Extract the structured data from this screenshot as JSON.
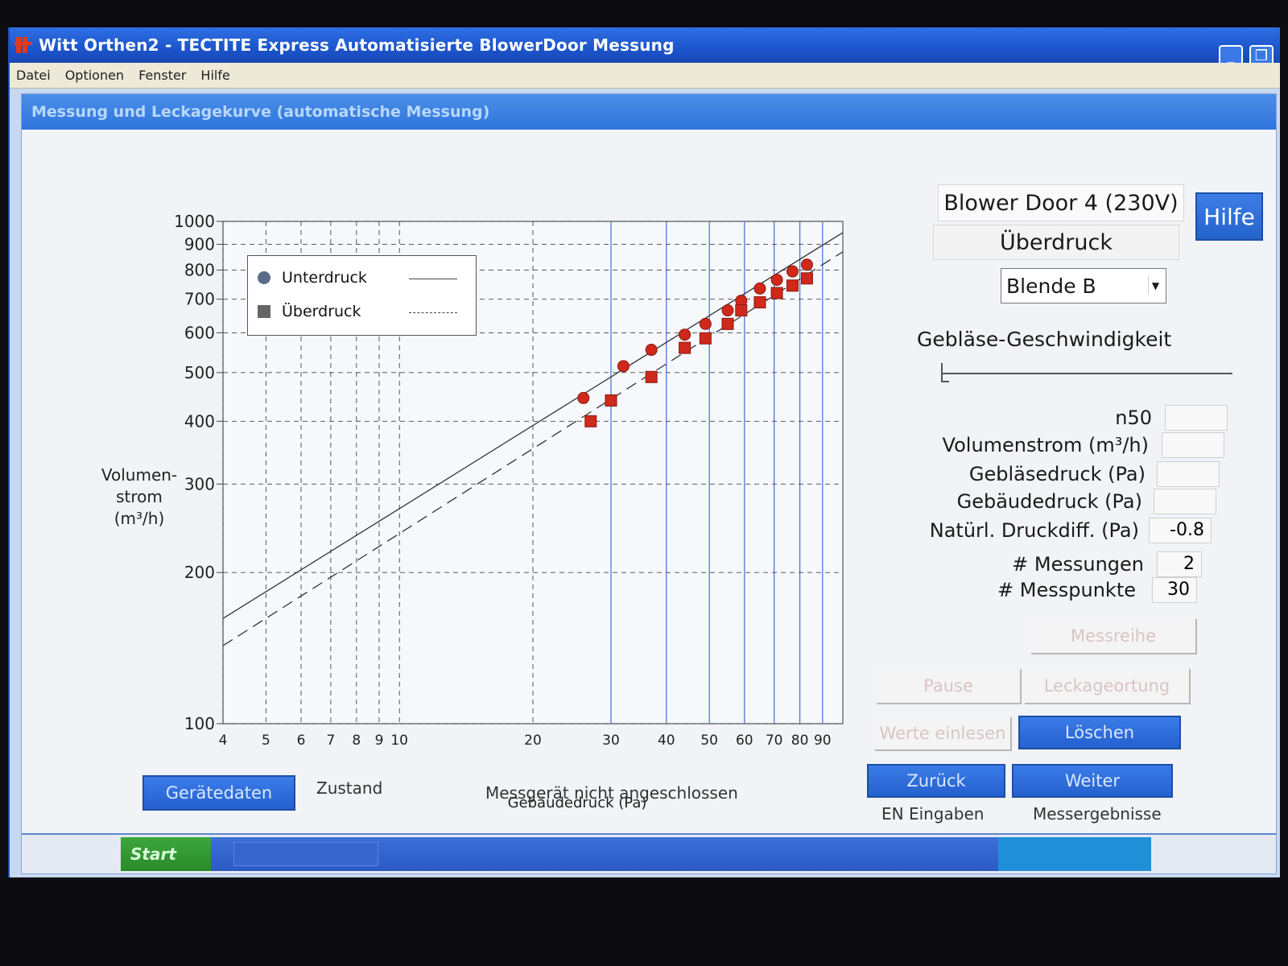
{
  "window": {
    "title": "Witt Orthen2 - TECTITE Express Automatisierte BlowerDoor Messung"
  },
  "menu": [
    "Datei",
    "Optionen",
    "Fenster",
    "Hilfe"
  ],
  "subwindow": {
    "title": "Messung und Leckagekurve (automatische Messung)"
  },
  "chart_data": {
    "type": "scatter",
    "xscale": "log",
    "yscale": "log",
    "xlabel": "Gebäudedruck (Pa)",
    "ylabel": "Volumen- strom (m³/h)",
    "ylabel_lines": [
      "Volumen-",
      "strom",
      "(m³/h)"
    ],
    "xlim": [
      4,
      100
    ],
    "ylim": [
      100,
      1000
    ],
    "x_ticks": [
      4,
      5,
      6,
      7,
      8,
      9,
      10,
      20,
      30,
      40,
      50,
      60,
      70,
      80,
      90
    ],
    "y_ticks": [
      100,
      200,
      300,
      400,
      500,
      600,
      700,
      800,
      900,
      1000
    ],
    "grid": true,
    "legend": "top-left",
    "series": [
      {
        "name": "Unterdruck",
        "marker": "circle",
        "line": "solid",
        "color": "#d1281c",
        "x": [
          26,
          32,
          37,
          44,
          49,
          55,
          59,
          65,
          71,
          77,
          83
        ],
        "y": [
          445,
          515,
          555,
          595,
          625,
          665,
          695,
          735,
          765,
          795,
          820
        ]
      },
      {
        "name": "Überdruck",
        "marker": "square",
        "line": "dashed",
        "color": "#d1281c",
        "x": [
          27,
          30,
          37,
          44,
          49,
          55,
          59,
          65,
          71,
          77,
          83
        ],
        "y": [
          400,
          440,
          490,
          560,
          585,
          625,
          665,
          690,
          720,
          745,
          770
        ]
      }
    ],
    "fit_lines": [
      {
        "series": "Unterdruck",
        "x": [
          4,
          100
        ],
        "y": [
          162,
          950
        ]
      },
      {
        "series": "Überdruck",
        "x": [
          4,
          100
        ],
        "y": [
          143,
          870
        ]
      }
    ]
  },
  "panel": {
    "device": "Blower Door 4 (230V)",
    "mode": "Überdruck",
    "help_button": "Hilfe",
    "blende": "Blende B",
    "speed_label": "Gebläse-Geschwindigkeit",
    "speed_value": 0,
    "fields": [
      {
        "label": "n50",
        "value": ""
      },
      {
        "label": "Volumenstrom (m³/h)",
        "value": ""
      },
      {
        "label": "Gebläsedruck (Pa)",
        "value": ""
      },
      {
        "label": "Gebäudedruck (Pa)",
        "value": ""
      },
      {
        "label": "Natürl. Druckdiff. (Pa)",
        "value": "-0.8"
      },
      {
        "label": "# Messungen",
        "value": "2"
      },
      {
        "label": "# Messpunkte",
        "value": "30"
      }
    ],
    "buttons": {
      "messreihe": "Messreihe",
      "pause": "Pause",
      "leckageortung": "Leckageortung",
      "werte_einlesen": "Werte einlesen",
      "loeschen": "Löschen",
      "zurueck": "Zurück",
      "weiter": "Weiter"
    },
    "nav_notes": {
      "back": "EN Eingaben",
      "next": "Messergebnisse"
    }
  },
  "bottom": {
    "geraetedaten": "Gerätedaten",
    "zustand_label": "Zustand",
    "zustand_value": "Messgerät nicht angeschlossen"
  },
  "taskbar": {
    "start": "Start"
  },
  "colors": {
    "accent": "#2a66d6",
    "marker": "#d1281c",
    "window": "#f1f3f6"
  }
}
